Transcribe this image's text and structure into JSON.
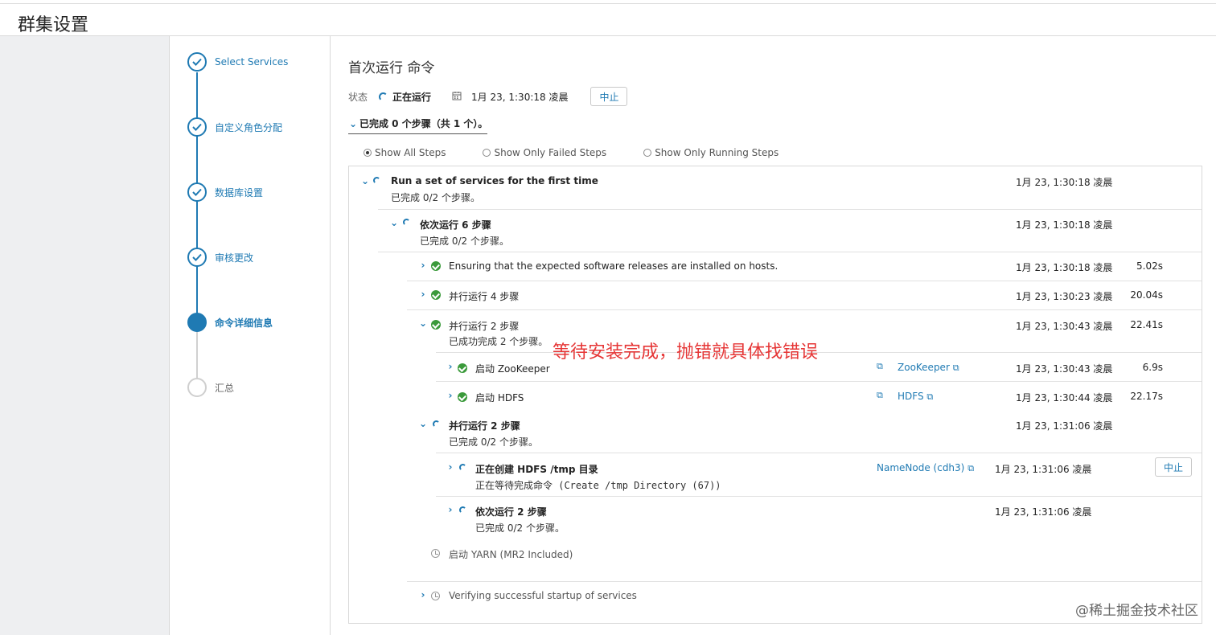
{
  "page": {
    "title": "群集设置"
  },
  "wizard": {
    "steps": [
      {
        "label": "Select Services",
        "state": "done"
      },
      {
        "label": "自定义角色分配",
        "state": "done"
      },
      {
        "label": "数据库设置",
        "state": "done"
      },
      {
        "label": "审核更改",
        "state": "done"
      },
      {
        "label": "命令详细信息",
        "state": "active"
      },
      {
        "label": "汇总",
        "state": "todo"
      }
    ]
  },
  "command": {
    "title": "首次运行 命令",
    "status_label": "状态",
    "status_value": "正在运行",
    "timestamp": "1月 23, 1:30:18 凌晨",
    "abort_label": "中止",
    "completed_summary": "已完成 0 个步骤（共 1 个）。"
  },
  "filters": {
    "options": [
      "Show All Steps",
      "Show Only Failed Steps",
      "Show Only Running Steps"
    ],
    "selected": "Show All Steps"
  },
  "steps": {
    "root": {
      "title": "Run a set of services for the first time",
      "sub": "已完成 0/2 个步骤。",
      "time": "1月 23, 1:30:18 凌晨"
    },
    "seq6": {
      "title": "依次运行 6 步骤",
      "sub": "已完成 0/2 个步骤。",
      "time": "1月 23, 1:30:18 凌晨"
    },
    "ensure": {
      "title": "Ensuring that the expected software releases are installed on hosts.",
      "time": "1月 23, 1:30:18 凌晨",
      "duration": "5.02s"
    },
    "par4": {
      "title": "并行运行 4 步骤",
      "time": "1月 23, 1:30:23 凌晨",
      "duration": "20.04s"
    },
    "par2a": {
      "title": "并行运行 2 步骤",
      "sub": "已成功完成 2 个步骤。",
      "time": "1月 23, 1:30:43 凌晨",
      "duration": "22.41s"
    },
    "zk": {
      "title": "启动 ZooKeeper",
      "link": "ZooKeeper",
      "time": "1月 23, 1:30:43 凌晨",
      "duration": "6.9s"
    },
    "hdfs": {
      "title": "启动 HDFS",
      "link": "HDFS",
      "time": "1月 23, 1:30:44 凌晨",
      "duration": "22.17s"
    },
    "par2b": {
      "title": "并行运行 2 步骤",
      "sub": "已完成 0/2 个步骤。",
      "time": "1月 23, 1:31:06 凌晨"
    },
    "tmp": {
      "title": "正在创建 HDFS /tmp 目录",
      "sub": "正在等待完成命令 (Create /tmp Directory (67))",
      "link": "NameNode (cdh3)",
      "time": "1月 23, 1:31:06 凌晨",
      "abort": "中止"
    },
    "seq2": {
      "title": "依次运行 2 步骤",
      "sub": "已完成 0/2 个步骤。",
      "time": "1月 23, 1:31:06 凌晨"
    },
    "yarn": {
      "title": "启动 YARN (MR2 Included)"
    },
    "verify": {
      "title": "Verifying successful startup of services"
    }
  },
  "annotation": "等待安装完成，抛错就具体找错误",
  "watermark": "@稀土掘金技术社区",
  "colors": {
    "accent": "#1f7ab3",
    "success": "#3b9a3b",
    "annotation": "#e63636"
  },
  "icons": {
    "done": "check-circle-icon",
    "running": "spinner-icon",
    "pending": "clock-icon",
    "expand": "chevron-right-icon",
    "collapse": "chevron-down-icon",
    "calendar": "calendar-icon",
    "external": "external-link-icon"
  }
}
